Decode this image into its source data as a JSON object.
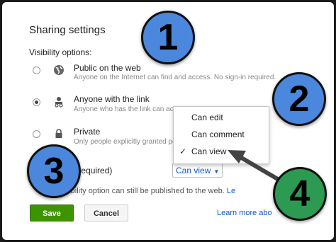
{
  "dialog": {
    "title": "Sharing settings",
    "visibility_label": "Visibility options:"
  },
  "options": [
    {
      "title": "Public on the web",
      "desc": "Anyone on the Internet can find and access. No sign-in required.",
      "icon": "globe-icon",
      "selected": false
    },
    {
      "title": "Anyone with the link",
      "desc": "Anyone who has the link can acc",
      "icon": "people-icon",
      "selected": true
    },
    {
      "title": "Private",
      "desc": "Only people explicitly granted pe",
      "icon": "lock-icon",
      "selected": false
    }
  ],
  "access": {
    "label": "e (no sign-in required)",
    "value": "Can view",
    "caret": "▼"
  },
  "note": {
    "text": "any visibility option can still be published to the web.",
    "link": "Le"
  },
  "buttons": {
    "save": "Save",
    "cancel": "Cancel"
  },
  "learn_more": "Learn more abo",
  "dropdown_menu": {
    "items": [
      "Can edit",
      "Can comment",
      "Can view"
    ],
    "selected": "Can view",
    "check_glyph": "✓"
  },
  "callouts": [
    "1",
    "2",
    "3",
    "4"
  ],
  "colors": {
    "badge_blue": "#4a87dd",
    "badge_green": "#2c9a52",
    "save_green": "#3d9400",
    "link_blue": "#1155cc"
  }
}
